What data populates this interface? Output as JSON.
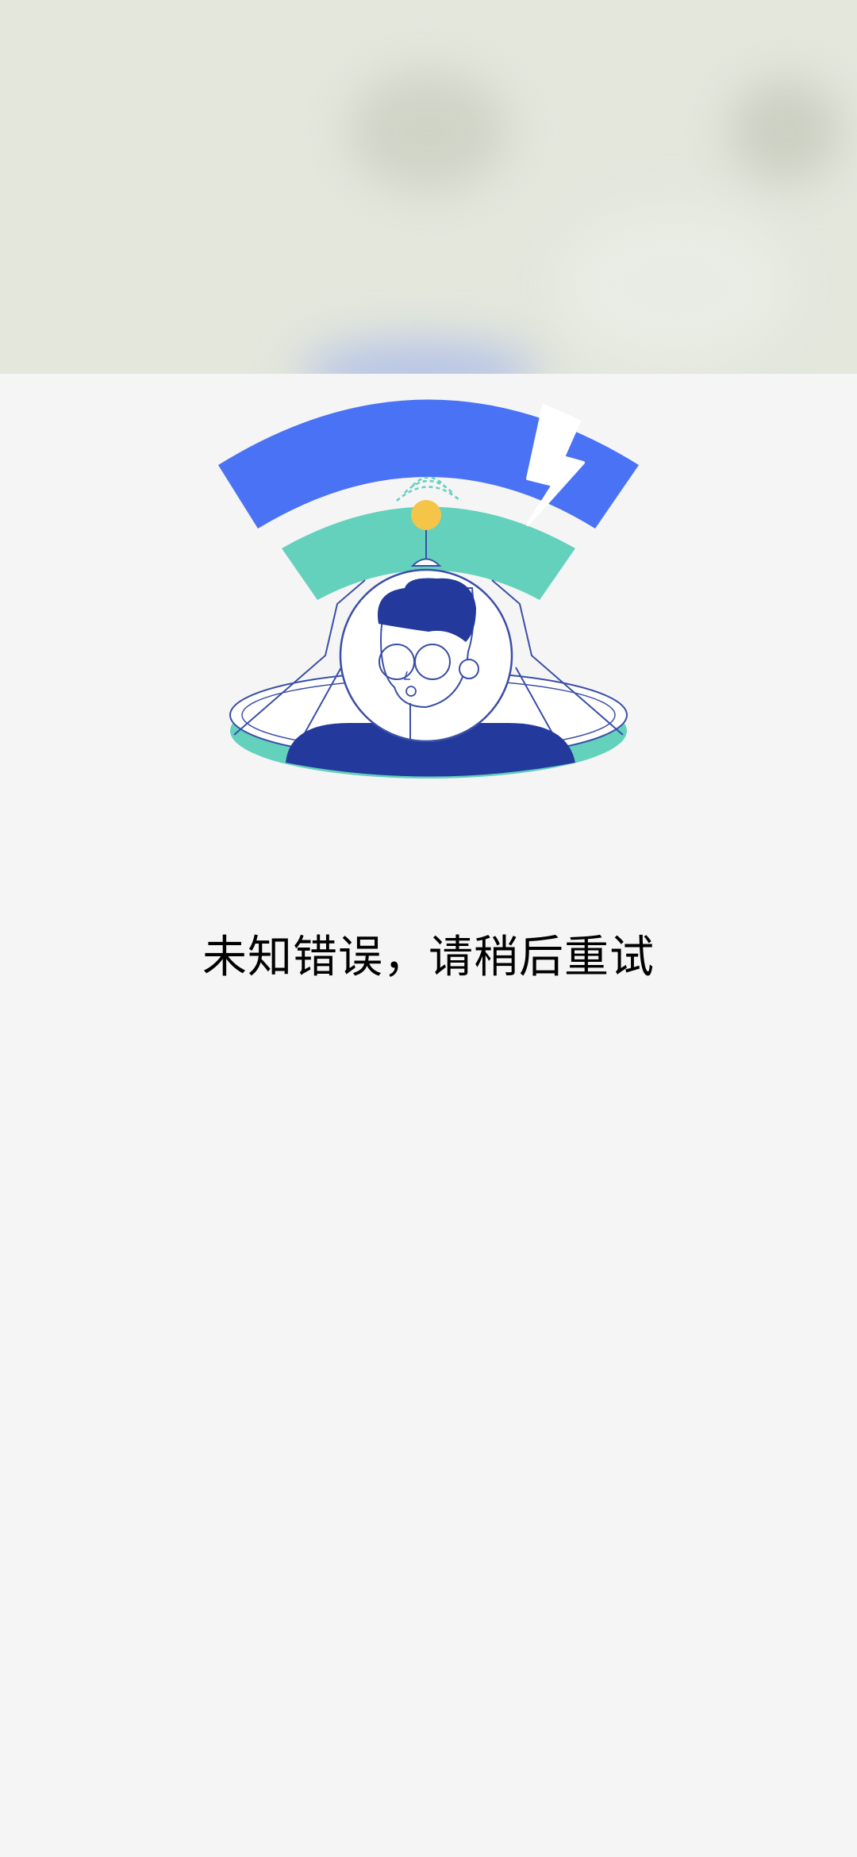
{
  "error": {
    "message": "未知错误，请稍后重试",
    "illustration_icon": "network-error-illustration-icon"
  },
  "colors": {
    "page_background": "#f5f5f5",
    "top_banner_background": "#e3e7dc",
    "wifi_outer_arc": "#4a72f5",
    "wifi_inner_arc": "#63d1bc",
    "person_dark": "#233a9c",
    "signal_dot": "#f5c54a",
    "platform": "#63d1bc",
    "text": "#000000"
  }
}
